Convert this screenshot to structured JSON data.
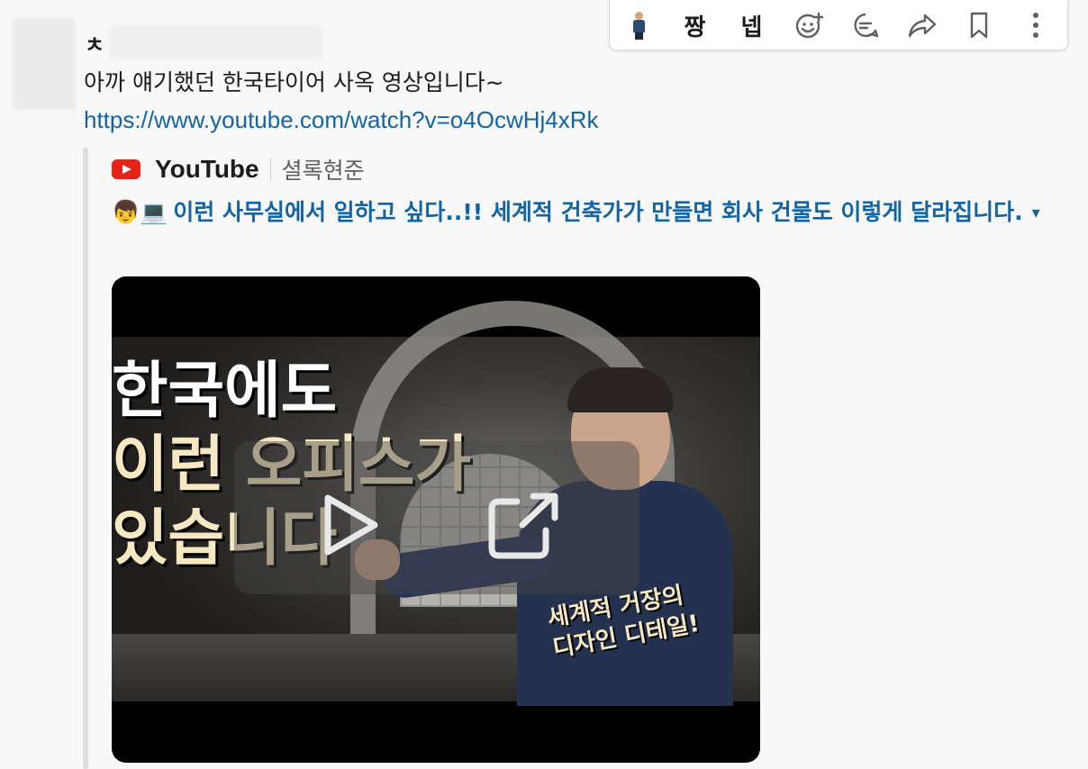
{
  "message": {
    "sender_initial": "ㅊ",
    "text": "아까 얘기했던 한국타이어 사옥 영상입니다~",
    "link": "https://www.youtube.com/watch?v=o4OcwHj4xRk"
  },
  "attachment": {
    "service_name": "YouTube",
    "author": "셜록현준",
    "title_emoji": "👦💻",
    "title": "이런 사무실에서 일하고 싶다..!! 세계적 건축가가 만들면 회사 건물도 이렇게 달라집니다.",
    "caret": "▾"
  },
  "video": {
    "thumb_line1": "한국에도",
    "thumb_line2": "이런 오피스가",
    "thumb_line3": "있습니다",
    "thumb_side": "세계적 거장의\n디자인 디테일!",
    "play_icon": "play-icon",
    "open_icon": "open-external-icon"
  },
  "toolbar": {
    "emoji_a": "짱",
    "emoji_b": "넵",
    "icons": [
      "person-emoji",
      "add-reaction-icon",
      "reply-in-thread-icon",
      "share-icon",
      "bookmark-icon",
      "more-actions-icon"
    ]
  },
  "colors": {
    "link": "#1264a3",
    "youtube_red": "#e62117"
  }
}
